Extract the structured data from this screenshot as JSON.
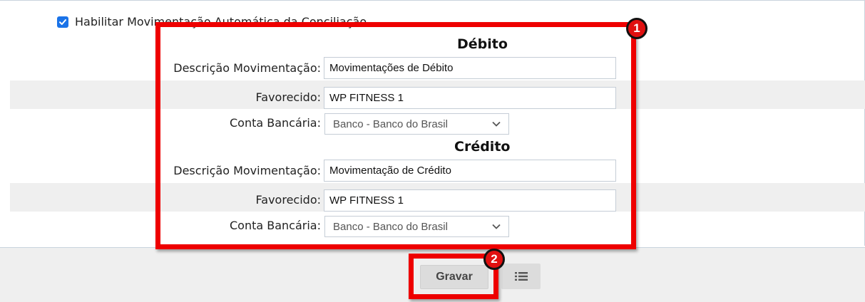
{
  "options": {
    "enable_label": "Habilitar Movimentação Automática da Conciliação",
    "enabled": true
  },
  "debito": {
    "title": "Débito",
    "descricao_label": "Descrição Movimentação:",
    "descricao_value": "Movimentações de Débito",
    "favorecido_label": "Favorecido:",
    "favorecido_value": "WP FITNESS 1",
    "conta_label": "Conta Bancária:",
    "conta_value": "Banco - Banco do Brasil"
  },
  "credito": {
    "title": "Crédito",
    "descricao_label": "Descrição Movimentação:",
    "descricao_value": "Movimentação de Crédito",
    "favorecido_label": "Favorecido:",
    "favorecido_value": "WP FITNESS 1",
    "conta_label": "Conta Bancária:",
    "conta_value": "Banco - Banco do Brasil"
  },
  "footer": {
    "save_label": "Gravar",
    "list_icon": "list-icon"
  },
  "annotations": {
    "marker_1": "1",
    "marker_2": "2",
    "highlight_color": "#ee0000",
    "checkbox_color": "#1a73e8"
  }
}
